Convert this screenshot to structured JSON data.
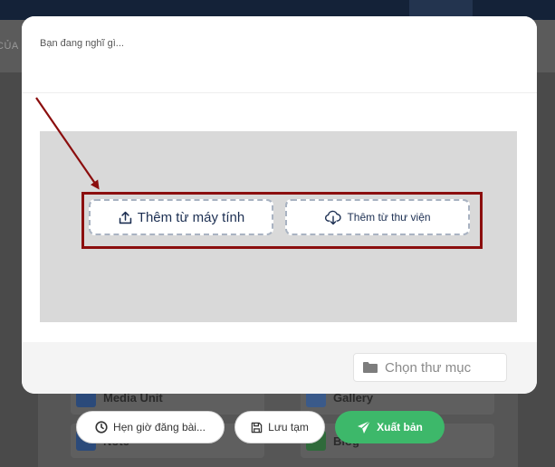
{
  "background": {
    "subbar_text": "CỦA",
    "items": [
      {
        "label": "Media Unit",
        "icon": "media-unit-icon"
      },
      {
        "label": "Gallery",
        "icon": "gallery-icon"
      },
      {
        "label": "Note",
        "icon": "note-icon"
      },
      {
        "label": "Blog",
        "icon": "blog-icon"
      }
    ]
  },
  "modal": {
    "post_placeholder": "Bạn đang nghĩ gì...",
    "upload": {
      "from_computer_label": "Thêm từ máy tính",
      "from_library_label": "Thêm từ thư viện"
    },
    "folder_select_label": "Chọn thư mục"
  },
  "actions": {
    "schedule_label": "Hẹn giờ đăng bài...",
    "draft_label": "Lưu tạm",
    "publish_label": "Xuất bản"
  },
  "colors": {
    "annotation_red": "#8b0e0e",
    "publish_green": "#3db86a",
    "navy_text": "#1c2f52"
  }
}
